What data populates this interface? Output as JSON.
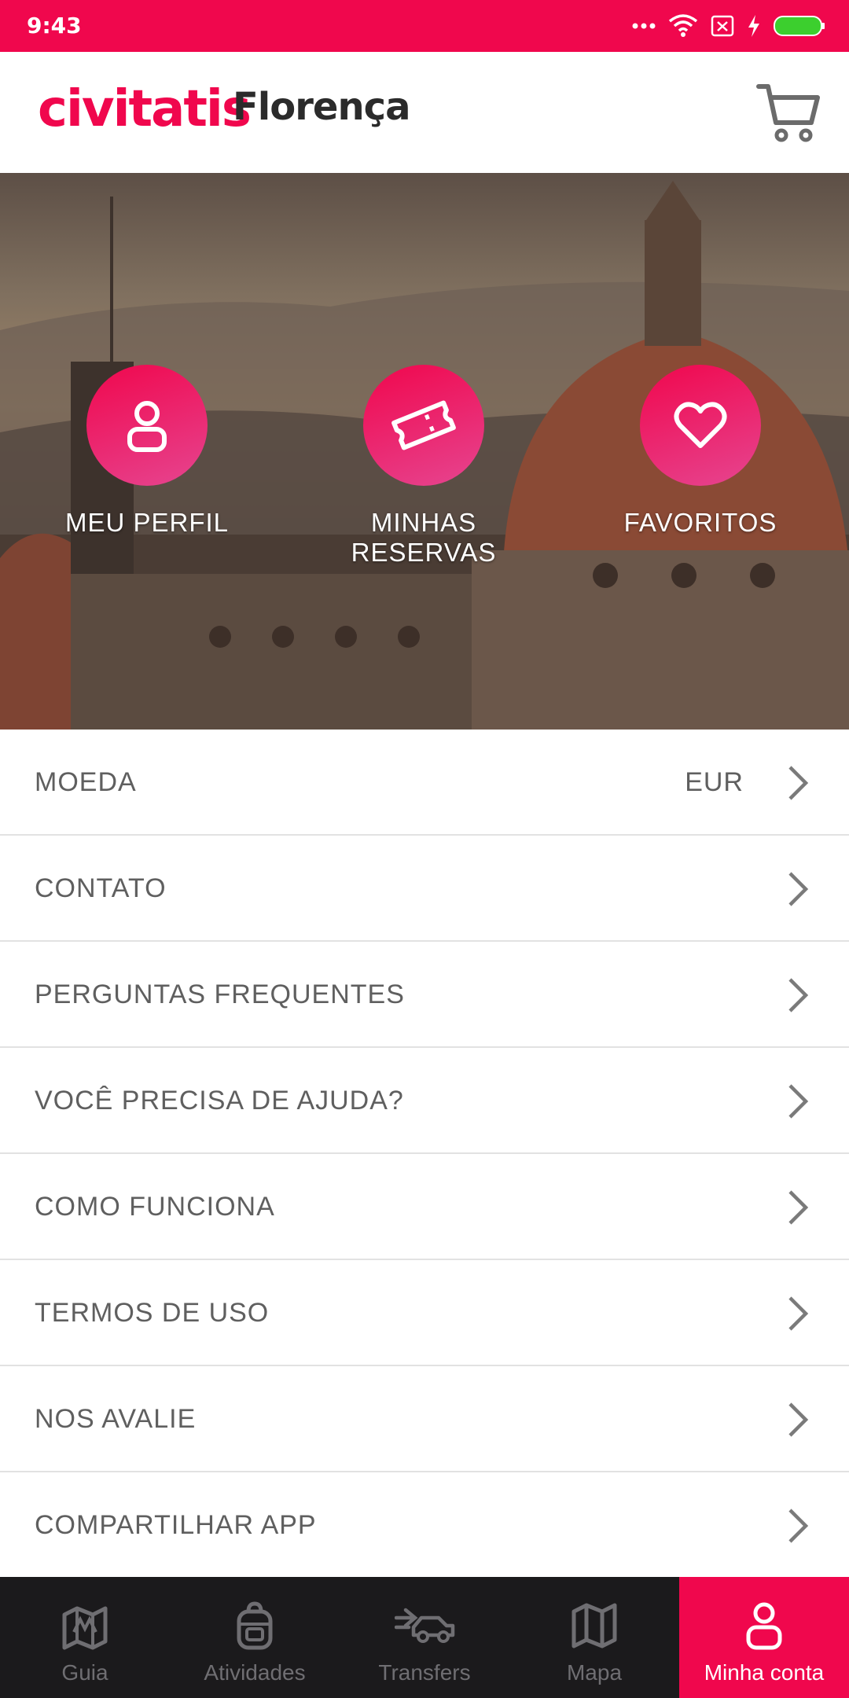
{
  "status_bar": {
    "time": "9:43"
  },
  "header": {
    "brand": "civitatis",
    "city": "Florença",
    "cart_icon": "cart-icon"
  },
  "hero": {
    "items": [
      {
        "label": "MEU PERFIL",
        "icon": "person-icon"
      },
      {
        "label": "MINHAS RESERVAS",
        "icon": "ticket-icon"
      },
      {
        "label": "FAVORITOS",
        "icon": "heart-icon"
      }
    ]
  },
  "menu": {
    "items": [
      {
        "label": "MOEDA",
        "value": "EUR"
      },
      {
        "label": "CONTATO"
      },
      {
        "label": "PERGUNTAS FREQUENTES"
      },
      {
        "label": "VOCÊ PRECISA DE AJUDA?"
      },
      {
        "label": "COMO FUNCIONA"
      },
      {
        "label": "TERMOS DE USO"
      },
      {
        "label": "NOS AVALIE"
      },
      {
        "label": "COMPARTILHAR APP"
      }
    ]
  },
  "bottom_nav": {
    "items": [
      {
        "label": "Guia",
        "icon": "map-pin-icon"
      },
      {
        "label": "Atividades",
        "icon": "backpack-icon"
      },
      {
        "label": "Transfers",
        "icon": "car-icon"
      },
      {
        "label": "Mapa",
        "icon": "map-icon"
      },
      {
        "label": "Minha conta",
        "icon": "person-icon",
        "active": true
      }
    ]
  },
  "colors": {
    "accent": "#f0074d",
    "nav_bg": "#1b1a1c",
    "text": "#5f5f5f"
  }
}
